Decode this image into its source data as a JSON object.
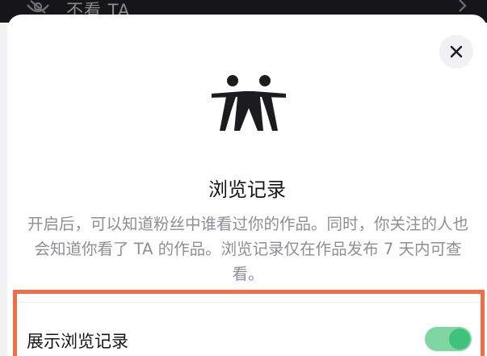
{
  "background_row": {
    "label": "不看 TA",
    "icon": "eye-off-icon",
    "trailing_icon": "chevron-right-icon"
  },
  "sheet": {
    "close_icon": "close-icon",
    "hero_icon": "people-icon",
    "title": "浏览记录",
    "description": "开启后，可以知道粉丝中谁看过你的作品。同时，你关注的人也会知道你看了 TA 的作品。浏览记录仅在作品发布 7 天内可查看。",
    "setting": {
      "label": "展示浏览记录",
      "enabled": true
    }
  },
  "colors": {
    "toggle_on": "#3fc27a",
    "highlight_border": "#f26c46"
  }
}
